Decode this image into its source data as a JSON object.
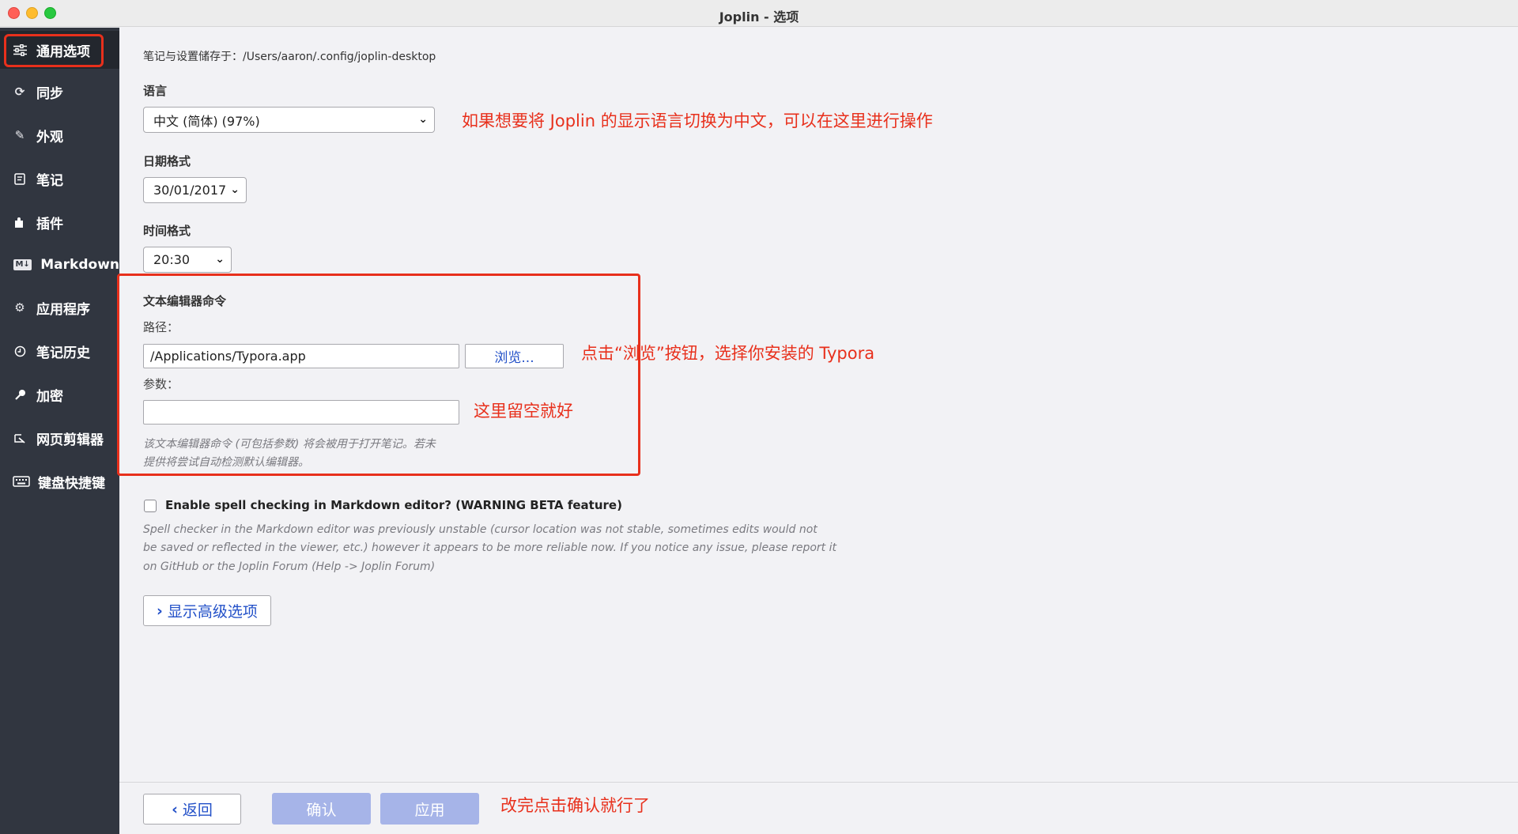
{
  "window": {
    "title": "Joplin - 选项"
  },
  "sidebar": {
    "items": [
      {
        "label": "通用选项",
        "icon": "sliders-icon"
      },
      {
        "label": "同步",
        "icon": "sync-icon"
      },
      {
        "label": "外观",
        "icon": "magic-wand-icon"
      },
      {
        "label": "笔记",
        "icon": "note-icon"
      },
      {
        "label": "插件",
        "icon": "puzzle-icon"
      },
      {
        "label": "Markdown",
        "icon": "markdown-icon"
      },
      {
        "label": "应用程序",
        "icon": "gear-icon"
      },
      {
        "label": "笔记历史",
        "icon": "history-icon"
      },
      {
        "label": "加密",
        "icon": "key-icon"
      },
      {
        "label": "网页剪辑器",
        "icon": "clipper-icon"
      },
      {
        "label": "键盘快捷键",
        "icon": "keyboard-icon"
      }
    ],
    "active_index": 0
  },
  "main": {
    "storage_path": "笔记与设置储存于：/Users/aaron/.config/joplin-desktop",
    "language": {
      "label": "语言",
      "value": "中文 (简体) (97%)"
    },
    "date_format": {
      "label": "日期格式",
      "value": "30/01/2017"
    },
    "time_format": {
      "label": "时间格式",
      "value": "20:30"
    },
    "editor": {
      "section_label": "文本编辑器命令",
      "path_label": "路径：",
      "path_value": "/Applications/Typora.app",
      "browse_label": "浏览...",
      "args_label": "参数：",
      "args_value": "",
      "hint_line1": "该文本编辑器命令 (可包括参数) 将会被用于打开笔记。若未",
      "hint_line2": "提供将尝试自动检测默认编辑器。"
    },
    "spellcheck": {
      "checked": false,
      "label": "Enable spell checking in Markdown editor? (WARNING BETA feature)",
      "desc_line1": "Spell checker in the Markdown editor was previously unstable (cursor location was not stable, sometimes edits would not",
      "desc_line2": "be saved or reflected in the viewer, etc.) however it appears to be more reliable now. If you notice any issue, please report it",
      "desc_line3": "on GitHub or the Joplin Forum (Help -> Joplin Forum)"
    },
    "advanced_button": "显示高级选项"
  },
  "annotations": {
    "language": "如果想要将 Joplin 的显示语言切换为中文，可以在这里进行操作",
    "browse": "点击“浏览”按钮，选择你安装的 Typora",
    "args": "这里留空就好",
    "confirm": "改完点击确认就行了"
  },
  "footer": {
    "back": "返回",
    "ok": "确认",
    "apply": "应用"
  },
  "colors": {
    "sidebar_bg": "#313640",
    "accent_blue": "#2250c8",
    "annotation_red": "#e8301c",
    "disabled_primary": "#a6b4e8"
  }
}
